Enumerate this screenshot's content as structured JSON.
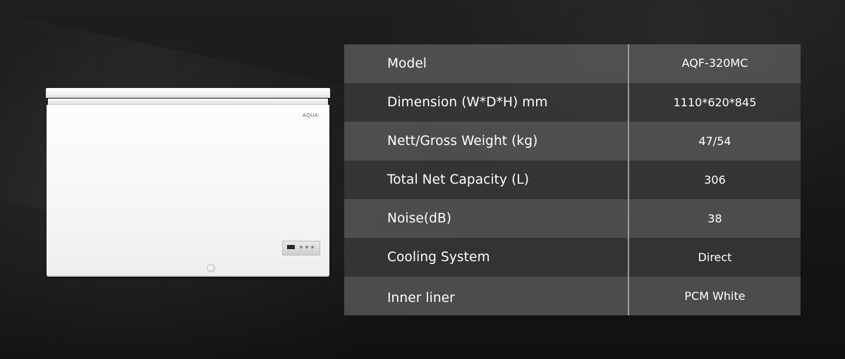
{
  "product": {
    "brand": "AQUA"
  },
  "specs": [
    {
      "label": "Model",
      "value": "AQF-320MC"
    },
    {
      "label": "Dimension (W*D*H) mm",
      "value": "1110*620*845"
    },
    {
      "label": "Nett/Gross Weight (kg)",
      "value": "47/54"
    },
    {
      "label": "Total Net Capacity (L)",
      "value": "306"
    },
    {
      "label": "Noise(dB)",
      "value": "38"
    },
    {
      "label": "Cooling System",
      "value": "Direct"
    },
    {
      "label": "Inner liner",
      "value": "PCM White"
    }
  ],
  "colors": {
    "background": "#171717",
    "row_light": "#5c5c5c",
    "row_dark": "#3c3c3c",
    "divider": "#9a9a9a",
    "text": "#ffffff"
  }
}
